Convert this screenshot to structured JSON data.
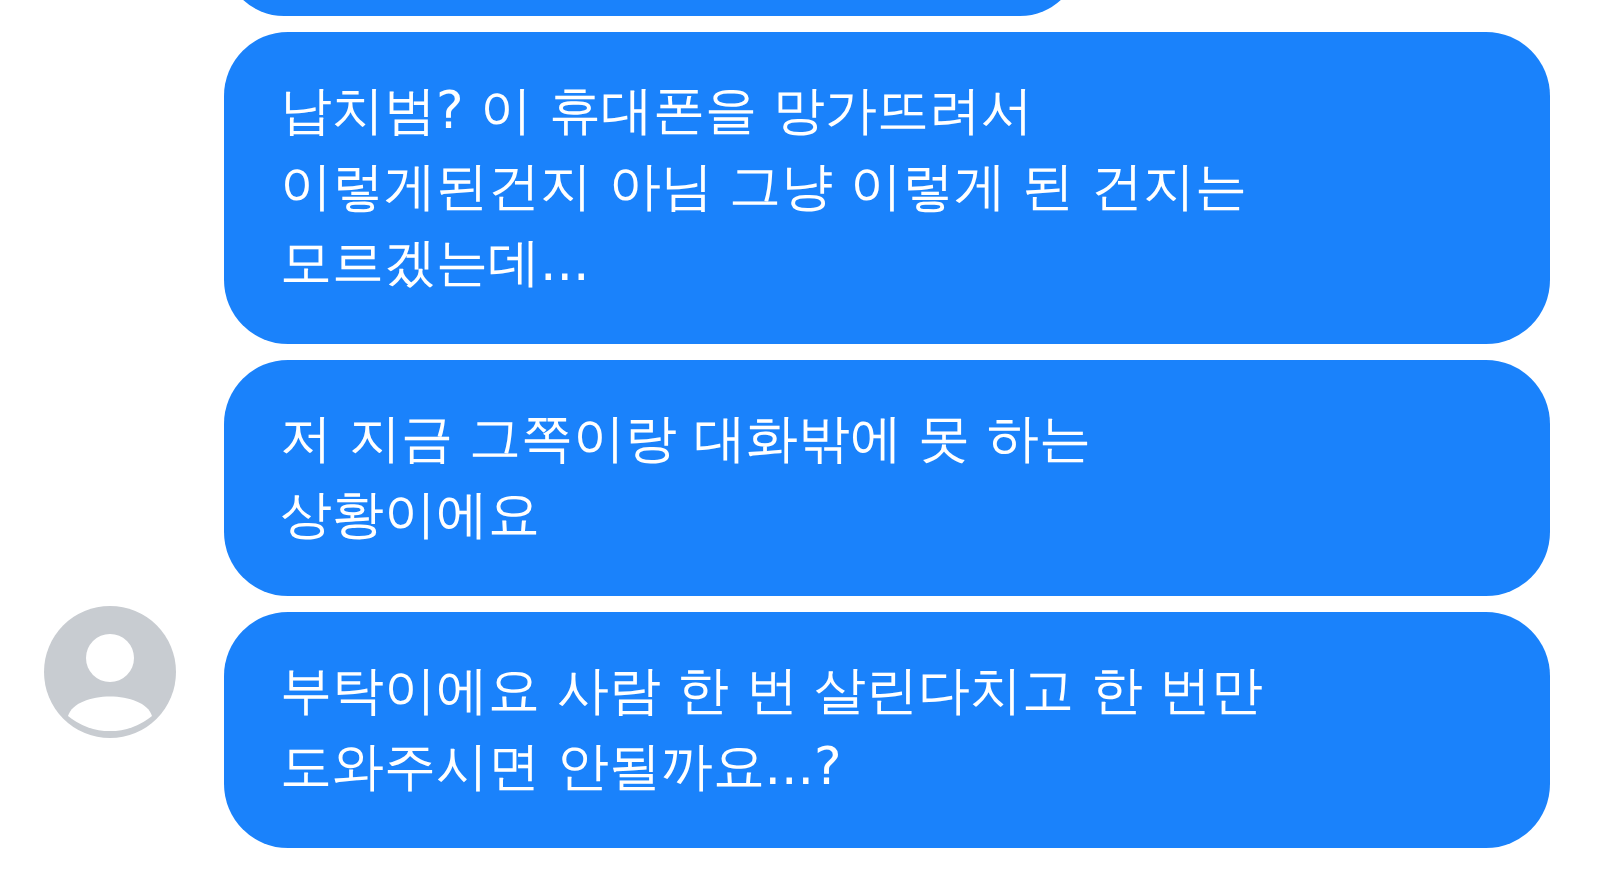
{
  "messages": [
    {
      "kind": "clipped",
      "avatar": false
    },
    {
      "kind": "text",
      "avatar": false,
      "text": "납치범? 이 휴대폰을 망가뜨려서\n이렇게된건지 아님 그냥 이렇게 된 건지는\n모르겠는데..."
    },
    {
      "kind": "text",
      "avatar": false,
      "text": "저 지금 그쪽이랑 대화밖에 못 하는\n상황이에요"
    },
    {
      "kind": "text",
      "avatar": true,
      "text": "부탁이에요 사람 한 번 살린다치고 한 번만\n도와주시면 안될까요...?"
    }
  ]
}
